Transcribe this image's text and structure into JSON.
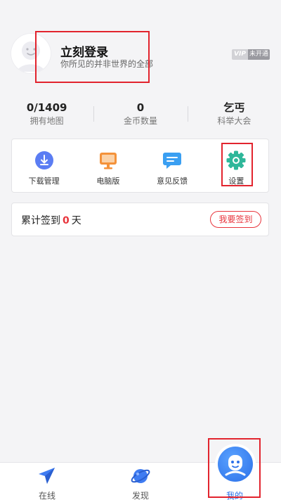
{
  "profile": {
    "title": "立刻登录",
    "subtitle": "你所见的并非世界的全部",
    "vip_tag": "VIP",
    "vip_state": "未开通"
  },
  "stats": [
    {
      "value": "0/1409",
      "label": "拥有地图"
    },
    {
      "value": "0",
      "label": "金币数量"
    },
    {
      "value": "乞丐",
      "label": "科举大会"
    }
  ],
  "tools": [
    {
      "label": "下载管理",
      "icon": "download-icon",
      "color": "#5b7df3"
    },
    {
      "label": "电脑版",
      "icon": "monitor-icon",
      "color": "#f4923a"
    },
    {
      "label": "意见反馈",
      "icon": "feedback-icon",
      "color": "#3a9ff2"
    },
    {
      "label": "设置",
      "icon": "gear-icon",
      "color": "#2fb79a"
    }
  ],
  "signin": {
    "prefix": "累计签到",
    "days": "0",
    "suffix": "天",
    "button": "我要签到"
  },
  "nav": [
    {
      "label": "在线",
      "icon": "plane-icon"
    },
    {
      "label": "发现",
      "icon": "planet-icon"
    },
    {
      "label": "我的",
      "icon": "face-icon",
      "active": true
    }
  ],
  "colors": {
    "accent_red": "#e8343c",
    "active_blue": "#2a6fe8",
    "highlight_box": "#e2242e"
  }
}
